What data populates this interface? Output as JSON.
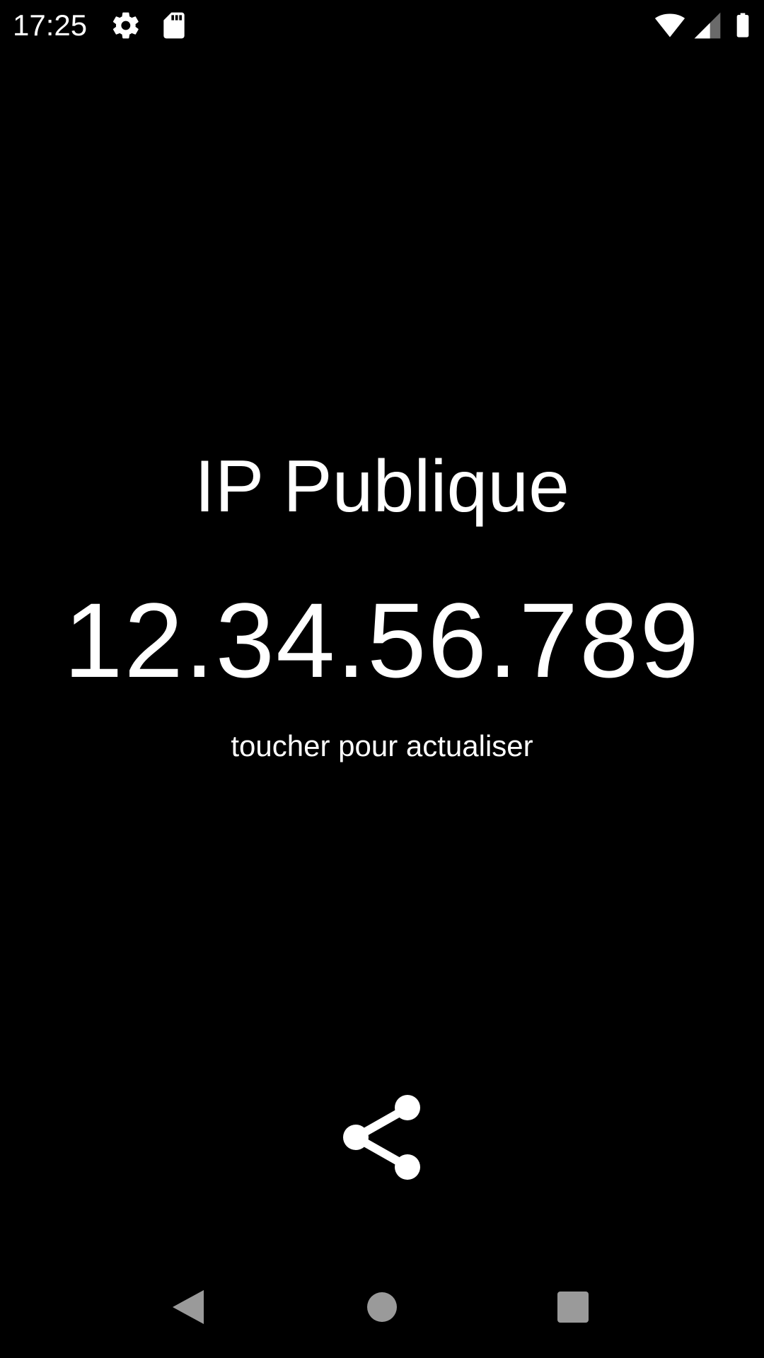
{
  "status_bar": {
    "time": "17:25",
    "icons": [
      "gear-icon",
      "sd-card-icon",
      "wifi-icon",
      "cell-signal-icon",
      "battery-icon"
    ]
  },
  "main": {
    "title": "IP Publique",
    "ip_address": "12.34.56.789",
    "hint": "toucher pour actualiser",
    "share_icon": "share-icon"
  },
  "nav_bar": {
    "icons": [
      "back-icon",
      "home-icon",
      "recents-icon"
    ]
  },
  "colors": {
    "background": "#000000",
    "foreground": "#ffffff",
    "nav_icon": "#9a9a9a"
  }
}
